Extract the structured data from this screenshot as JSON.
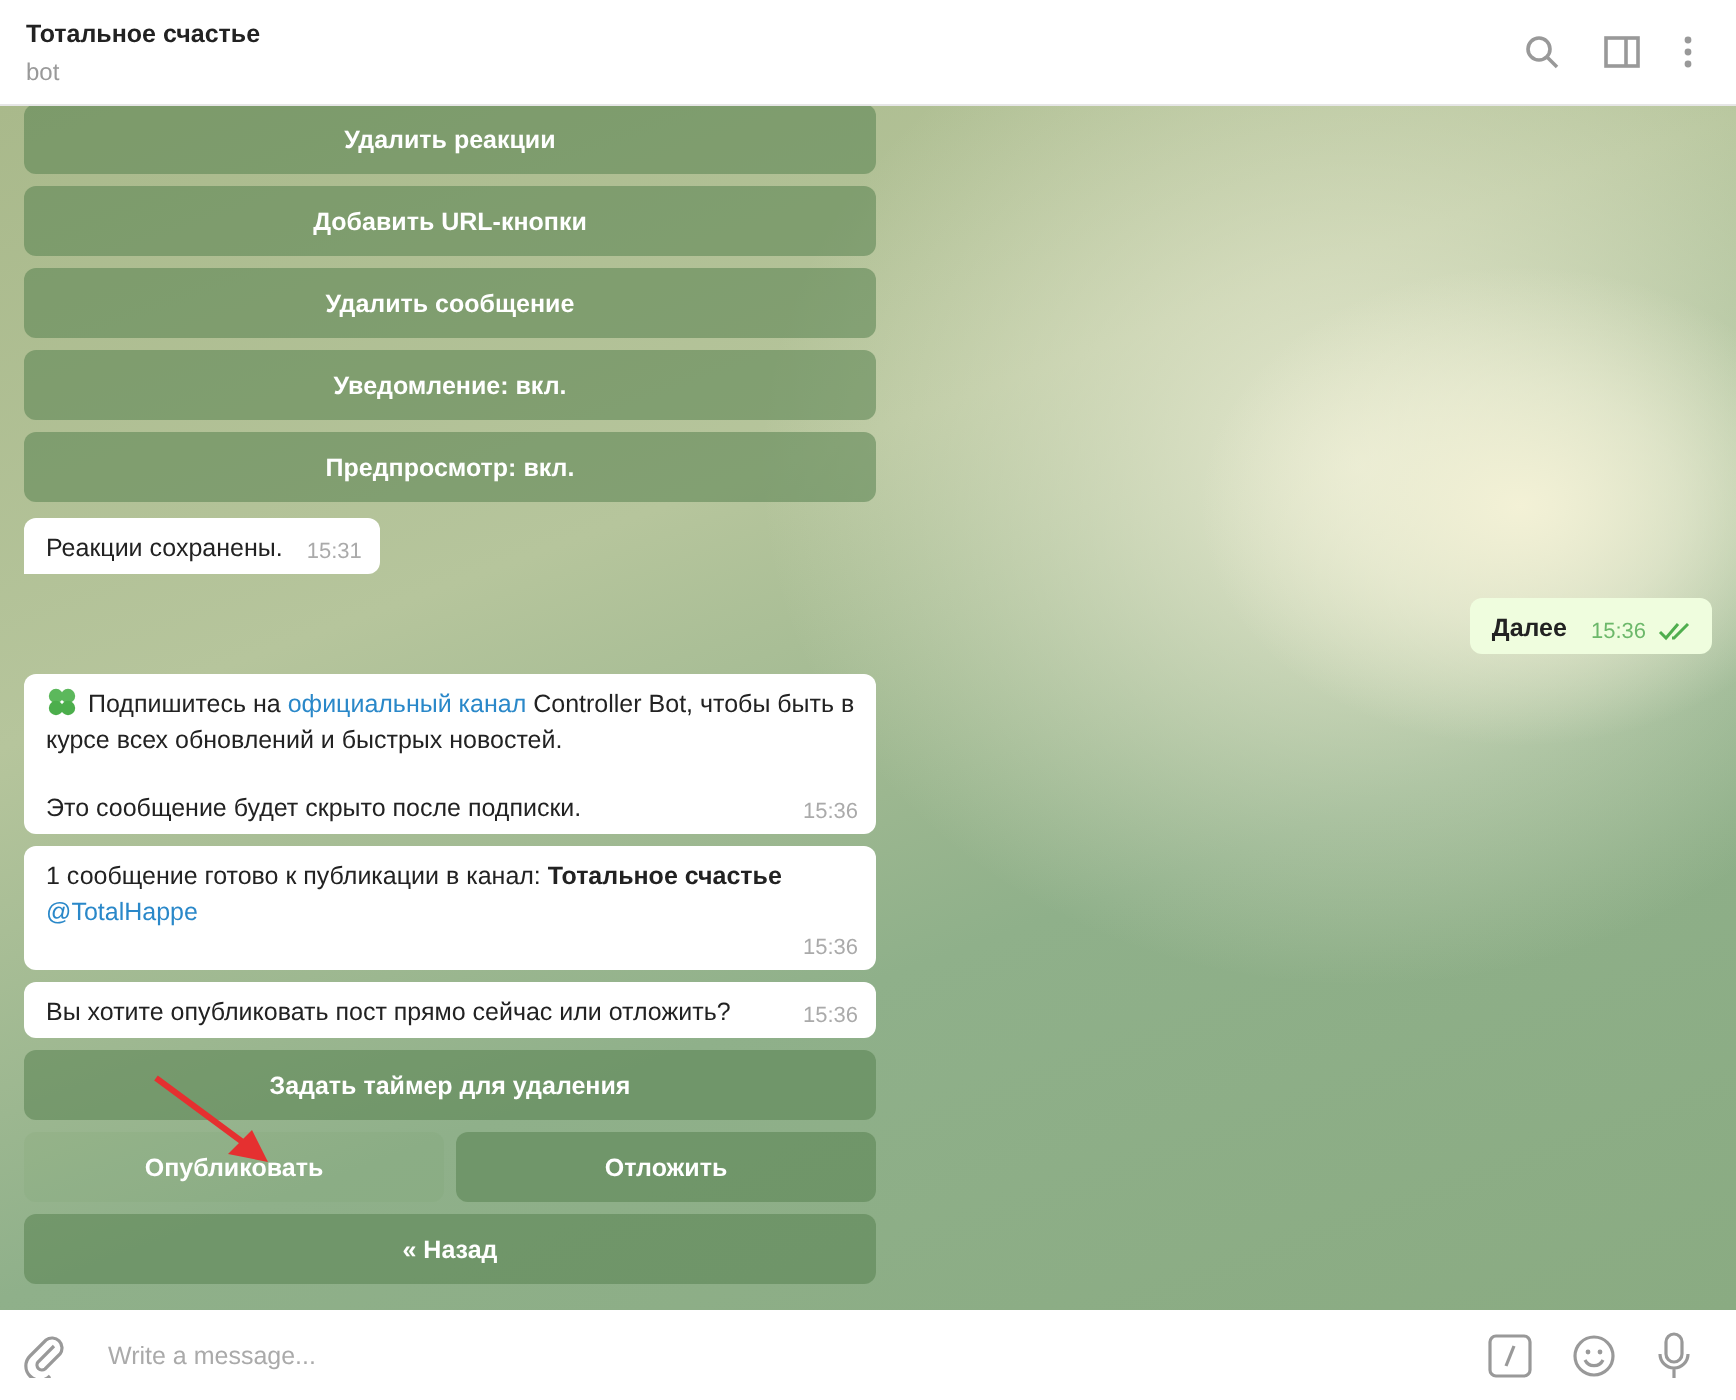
{
  "header": {
    "title": "Тотальное счастье",
    "subtitle": "bot"
  },
  "messages": [
    {
      "kind": "keyboard",
      "rows": [
        [
          {
            "label": "Удалить реакции",
            "pressed": false
          }
        ],
        [
          {
            "label": "Добавить URL-кнопки",
            "pressed": false
          }
        ],
        [
          {
            "label": "Удалить сообщение",
            "pressed": false
          }
        ],
        [
          {
            "label": "Уведомление: вкл.",
            "pressed": false
          }
        ],
        [
          {
            "label": "Предпросмотр: вкл.",
            "pressed": false
          }
        ]
      ]
    },
    {
      "kind": "incoming",
      "tail": true,
      "paragraphs": [
        [
          {
            "kind": "text",
            "text": "Реакции сохранены."
          }
        ]
      ],
      "time": "15:31"
    },
    {
      "kind": "outgoing",
      "read": true,
      "paragraphs": [
        [
          {
            "kind": "bold",
            "text": "Далее"
          }
        ]
      ],
      "time": "15:36"
    },
    {
      "kind": "incoming",
      "tail": false,
      "clover": true,
      "paragraphs": [
        [
          {
            "kind": "text",
            "text": "Подпишитесь на "
          },
          {
            "kind": "link",
            "text": "официальный канал"
          },
          {
            "kind": "text",
            "text": " Controller Bot, чтобы быть в курсе всех обновлений и быстрых новостей."
          }
        ],
        [
          {
            "kind": "text",
            "text": "Это сообщение будет скрыто после подписки."
          }
        ]
      ],
      "time": "15:36"
    },
    {
      "kind": "incoming",
      "tail": false,
      "paragraphs": [
        [
          {
            "kind": "text",
            "text": "1 сообщение готово к публикации в канал: "
          },
          {
            "kind": "bold",
            "text": "Тотальное счастье"
          },
          {
            "kind": "link",
            "text": "@TotalHappe",
            "newline": true
          }
        ]
      ],
      "time": "15:36"
    },
    {
      "kind": "incoming",
      "tail": false,
      "paragraphs": [
        [
          {
            "kind": "text",
            "text": "Вы хотите опубликовать пост прямо сейчас или отложить?"
          }
        ]
      ],
      "time": "15:36"
    },
    {
      "kind": "keyboard",
      "rows": [
        [
          {
            "label": "Задать таймер для удаления",
            "pressed": false
          }
        ],
        [
          {
            "label": "Опубликовать",
            "pressed": true
          },
          {
            "label": "Отложить",
            "pressed": false
          }
        ],
        [
          {
            "label": "« Назад",
            "pressed": false
          }
        ]
      ]
    }
  ],
  "composer": {
    "placeholder": "Write a message..."
  }
}
